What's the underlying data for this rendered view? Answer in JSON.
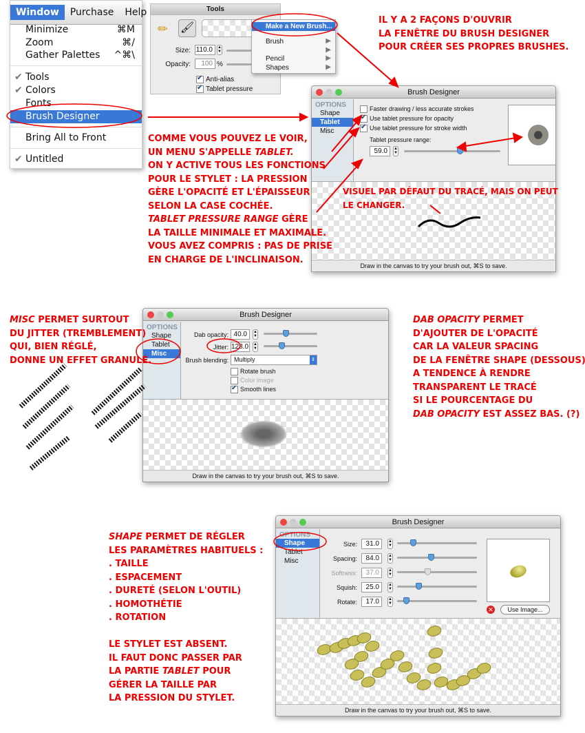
{
  "window_menu": {
    "bar": [
      "Window",
      "Purchase",
      "Help"
    ],
    "items": [
      {
        "label": "Minimize",
        "shortcut": "⌘M"
      },
      {
        "label": "Zoom",
        "shortcut": "⌘/"
      },
      {
        "label": "Gather Palettes",
        "shortcut": "^⌘\\"
      },
      {
        "label": "Tools",
        "checked": true
      },
      {
        "label": "Colors",
        "checked": true
      },
      {
        "label": "Fonts"
      },
      {
        "label": "Brush Designer",
        "highlighted": true
      },
      {
        "label": "Bring All to Front"
      },
      {
        "label": "Untitled",
        "checked": true
      }
    ]
  },
  "tools": {
    "title": "Tools",
    "size_label": "Size:",
    "size_value": "110.0",
    "opacity_label": "Opacity:",
    "opacity_value": "100",
    "opacity_unit": "%",
    "anti_alias": "Anti-alias",
    "tablet_pressure": "Tablet pressure"
  },
  "context_menu": {
    "items": [
      "Make a New Brush...",
      "Brush",
      "Pencil",
      "Shapes"
    ]
  },
  "window_title": "Brush Designer",
  "sidebar": {
    "header": "OPTIONS",
    "items": [
      "Shape",
      "Tablet",
      "Misc"
    ]
  },
  "status_text": "Draw in the canvas to try your brush out, ⌘S to save.",
  "tablet": {
    "faster": "Faster drawing / less accurate strokes",
    "opacity": "Use tablet pressure for opacity",
    "width": "Use tablet pressure for stroke width",
    "range_label": "Tablet pressure range:",
    "range_value": "59.0",
    "range_percent": 59
  },
  "misc": {
    "dab_label": "Dab opacity:",
    "dab_value": "40.0",
    "jitter_label": "Jitter:",
    "jitter_value": "128.0",
    "blending_label": "Brush blending:",
    "blending_value": "Multiply",
    "rotate": "Rotate brush",
    "color_image": "Color image",
    "smooth": "Smooth lines"
  },
  "shape": {
    "rows": [
      {
        "label": "Size:",
        "value": "31.0",
        "pct": 18
      },
      {
        "label": "Spacing:",
        "value": "84.0",
        "pct": 42
      },
      {
        "label": "Softness:",
        "value": "37.0",
        "pct": 37,
        "disabled": true
      },
      {
        "label": "Squish:",
        "value": "25.0",
        "pct": 25
      },
      {
        "label": "Rotate:",
        "value": "17.0",
        "pct": 8
      }
    ],
    "use_image": "Use Image..."
  },
  "notes": {
    "top_right": "Il y a 2 façons d'ouvrir\nla fenêtre du Brush Designer\npour créer ses propres Brushes.",
    "left_1": "Comme vous pouvez le voir,\nun menu s'appelle ",
    "left_1_em": "Tablet.",
    "left_2": "On y active tous les fonctions\npour le stylet : la pression\ngère l'opacité et l'épaisseur\nselon la case cochée.",
    "left_3_em": "Tablet pressure range",
    "left_3": " gère\nla taille minimale et maximale.\nVous avez compris : pas de prise\nen charge de l'inclinaison.",
    "canvas": "Visuel par défaut du tracé, mais on peut\nle changer.",
    "misc_em": "Misc",
    "misc": " permet surtout\ndu Jitter (tremblement)\nqui, bien réglé,\ndonne un effet Granulé.",
    "dab_em": "Dab opacity",
    "dab": " permet\nd'ajouter de l'opacité\ncar la valeur Spacing\nde la fenêtre Shape (dessous)\na tendence à rendre\ntransparent le tracé\nsi le pourcentage du\n",
    "dab_em2": "Dab Opacity",
    "dab_end": " est assez bas. (?)",
    "shape_em": "Shape",
    "shape": " permet de régler\nles paramètres habituels :\n. Taille\n. Espacement\n. Dureté (selon l'outil)\n. Homothétie\n. Rotation\n\nLe stylet est absent.\nIl faut donc passer par\nla partie ",
    "shape_em2": "tablet",
    "shape_end": " pour\ngérer la taille par\nla pression du stylet."
  },
  "colors": {
    "annotation": "#e00000",
    "selection": "#3a78d8"
  }
}
